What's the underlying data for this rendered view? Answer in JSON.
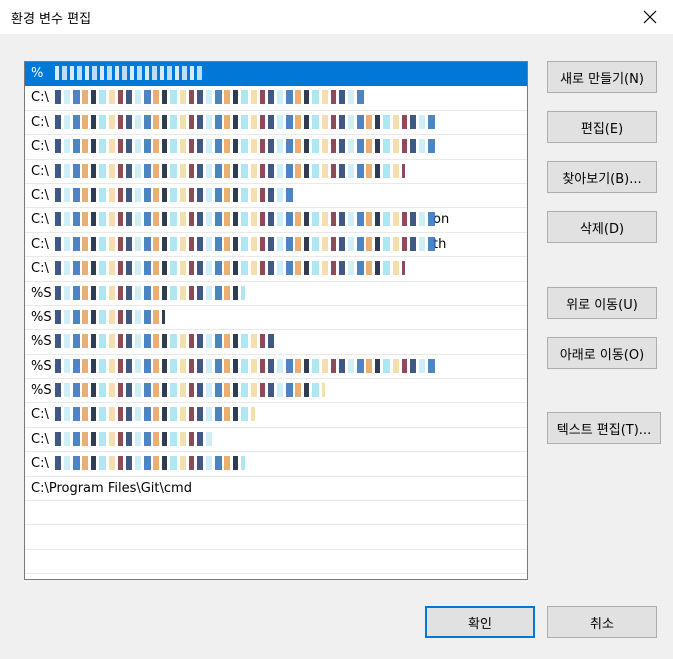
{
  "window": {
    "title": "환경 변수 편집",
    "close_icon": "close-icon"
  },
  "list": {
    "rows": [
      {
        "text": "%",
        "tail": "",
        "blur_width": 150,
        "selected": true
      },
      {
        "text": "C:\\",
        "tail": "",
        "blur_width": 310,
        "selected": false
      },
      {
        "text": "C:\\",
        "tail": "",
        "blur_width": 380,
        "selected": false
      },
      {
        "text": "C:\\",
        "tail": "",
        "blur_width": 380,
        "selected": false
      },
      {
        "text": "C:\\",
        "tail": "",
        "blur_width": 350,
        "selected": false
      },
      {
        "text": "C:\\",
        "tail": "",
        "blur_width": 240,
        "selected": false
      },
      {
        "text": "C:\\",
        "tail": "on",
        "blur_width": 380,
        "selected": false
      },
      {
        "text": "C:\\",
        "tail": "th",
        "blur_width": 380,
        "selected": false
      },
      {
        "text": "C:\\",
        "tail": "",
        "blur_width": 350,
        "selected": false
      },
      {
        "text": "%S",
        "tail": "",
        "blur_width": 190,
        "selected": false
      },
      {
        "text": "%S",
        "tail": "",
        "blur_width": 110,
        "selected": false
      },
      {
        "text": "%S",
        "tail": "",
        "blur_width": 220,
        "selected": false
      },
      {
        "text": "%S",
        "tail": "",
        "blur_width": 380,
        "selected": false
      },
      {
        "text": "%S",
        "tail": "",
        "blur_width": 270,
        "selected": false
      },
      {
        "text": "C:\\",
        "tail": "",
        "blur_width": 200,
        "selected": false
      },
      {
        "text": "C:\\",
        "tail": "",
        "blur_width": 160,
        "selected": false
      },
      {
        "text": "C:\\",
        "tail": "",
        "blur_width": 190,
        "selected": false
      },
      {
        "text": "C:\\Program Files\\Git\\cmd",
        "tail": "",
        "blur_width": 0,
        "selected": false
      },
      {
        "text": "",
        "tail": "",
        "blur_width": 0,
        "selected": false
      },
      {
        "text": "",
        "tail": "",
        "blur_width": 0,
        "selected": false
      },
      {
        "text": "",
        "tail": "",
        "blur_width": 0,
        "selected": false
      }
    ]
  },
  "buttons": {
    "new": "새로 만들기(N)",
    "edit": "편집(E)",
    "browse": "찾아보기(B)...",
    "delete": "삭제(D)",
    "move_up": "위로 이동(U)",
    "move_down": "아래로 이동(O)",
    "edit_text": "텍스트 편집(T)..."
  },
  "footer": {
    "ok": "확인",
    "cancel": "취소"
  },
  "colors": {
    "selection": "#0078d7",
    "background": "#f0f0f0",
    "button": "#e1e1e1"
  }
}
